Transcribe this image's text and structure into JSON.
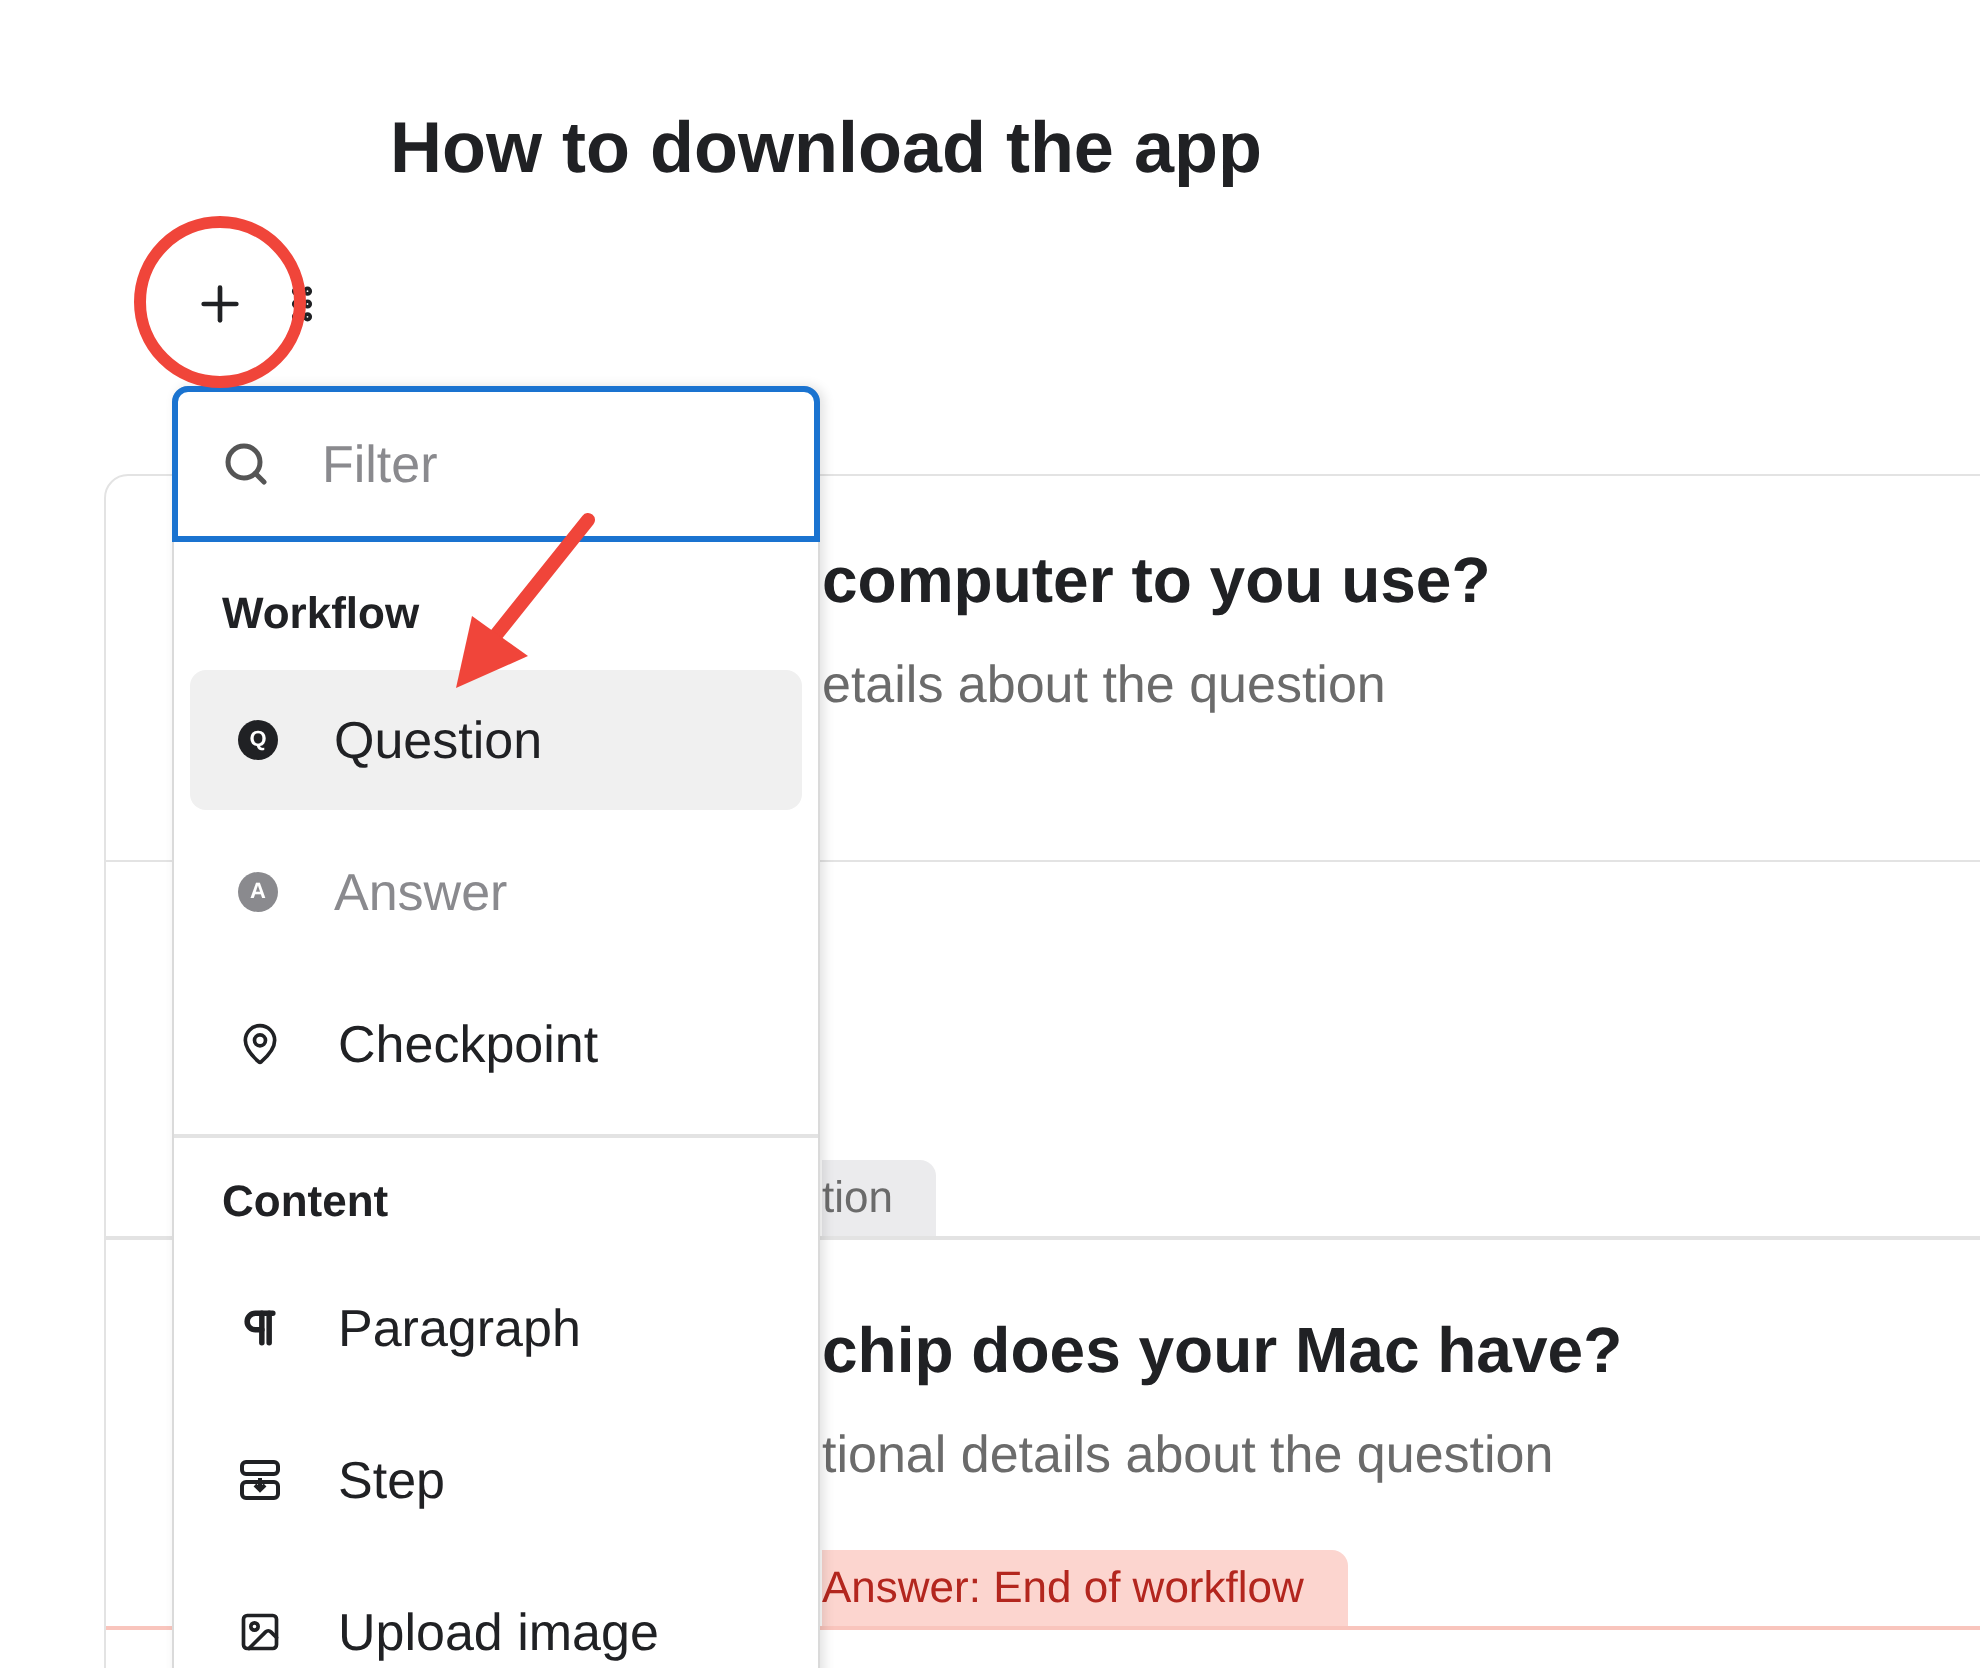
{
  "page": {
    "title": "How to download the app"
  },
  "card": {
    "blocks": [
      {
        "kind": "question",
        "title": "computer to you use?",
        "description": "etails about the question"
      },
      {
        "kind": "tag",
        "label": "tion"
      },
      {
        "kind": "question",
        "title": "chip does your Mac have?",
        "description": "tional details about the question"
      },
      {
        "kind": "end_tag",
        "label": "Answer: End of workflow"
      }
    ]
  },
  "menu": {
    "filter": {
      "placeholder": "Filter"
    },
    "groups": [
      {
        "heading": "Workflow",
        "items": [
          {
            "label": "Question",
            "kind": "letter",
            "badge": "Q",
            "selected": true,
            "disabled": false
          },
          {
            "label": "Answer",
            "kind": "letter",
            "badge": "A",
            "selected": false,
            "disabled": true
          },
          {
            "label": "Checkpoint",
            "kind": "pin",
            "selected": false,
            "disabled": false
          }
        ]
      },
      {
        "heading": "Content",
        "items": [
          {
            "label": "Paragraph",
            "kind": "paragraph",
            "selected": false,
            "disabled": false
          },
          {
            "label": "Step",
            "kind": "step",
            "selected": false,
            "disabled": false
          },
          {
            "label": "Upload image",
            "kind": "image",
            "selected": false,
            "disabled": false
          }
        ]
      }
    ]
  }
}
